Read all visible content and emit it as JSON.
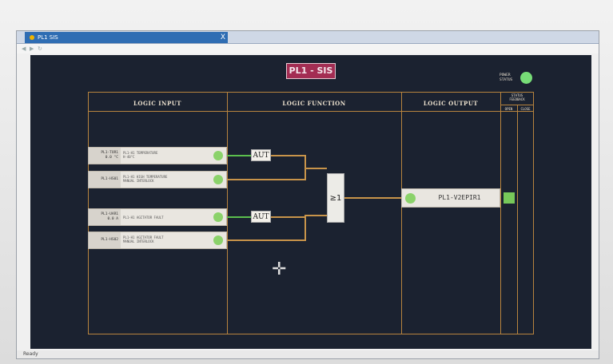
{
  "window": {
    "tab_title": "PL1 SIS",
    "close": "X",
    "status": "Ready"
  },
  "toolbar": {
    "icons": [
      "back-icon",
      "forward-icon",
      "refresh-icon"
    ]
  },
  "hmi": {
    "title": "PL1 - SIS",
    "power_status": {
      "line1": "POWER",
      "line2": "STATUS",
      "color": "#77dd77"
    },
    "headers": {
      "logic_input": "LOGIC INPUT",
      "logic_function": "LOGIC FUNCTION",
      "logic_output": "LOGIC OUTPUT",
      "status_feedback_line1": "STATUS",
      "status_feedback_line2": "FEEDBACK",
      "open": "OPEN",
      "close": "CLOSE"
    },
    "inputs": [
      {
        "tag": "PL1-TOR1",
        "value": "0.0 °C",
        "desc1": "PL1-H1 TEMPERATURE",
        "desc2": "H-40°C"
      },
      {
        "tag": "PL1-HS01",
        "value": "",
        "desc1": "PL1-H1 HIGH TEMPERATURE",
        "desc2": "MANUAL INTERLOCK"
      },
      {
        "tag": "PL1-UAR1",
        "value": "0.0 A",
        "desc1": "PL1-H1 AGITATOR FAULT",
        "desc2": ""
      },
      {
        "tag": "PL1-HS02",
        "value": "",
        "desc1": "PL1-H1 AGITATOR FAULT",
        "desc2": "MANUAL INTERLOCK"
      }
    ],
    "functions": {
      "aut1": "AUT",
      "aut2": "AUT",
      "or_gate": "≥1"
    },
    "output": {
      "label": "PL1-V2EPIR1"
    },
    "colors": {
      "border": "#b8843e",
      "lamp_green": "#8bd26a",
      "badge": "#a32d53",
      "background": "#1b2230"
    }
  }
}
